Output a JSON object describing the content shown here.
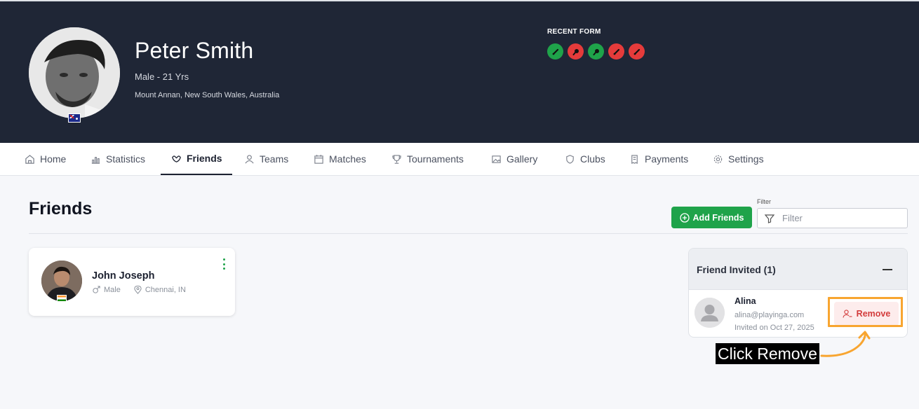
{
  "profile": {
    "name": "Peter Smith",
    "meta": "Male - 21 Yrs",
    "location": "Mount Annan, New South Wales, Australia",
    "recent_form_label": "RECENT FORM",
    "recent_form": [
      "win",
      "loss",
      "win",
      "loss",
      "loss"
    ]
  },
  "tabs": [
    {
      "label": "Home",
      "icon": "home-icon"
    },
    {
      "label": "Statistics",
      "icon": "statistics-icon"
    },
    {
      "label": "Friends",
      "icon": "friends-icon",
      "active": true
    },
    {
      "label": "Teams",
      "icon": "teams-icon"
    },
    {
      "label": "Matches",
      "icon": "calendar-icon"
    },
    {
      "label": "Tournaments",
      "icon": "trophy-icon"
    },
    {
      "label": "Gallery",
      "icon": "image-icon"
    },
    {
      "label": "Clubs",
      "icon": "shield-icon"
    },
    {
      "label": "Payments",
      "icon": "receipt-icon"
    },
    {
      "label": "Settings",
      "icon": "gear-icon"
    }
  ],
  "page": {
    "title": "Friends",
    "add_button": "Add Friends",
    "filter_label": "Filter",
    "filter_placeholder": "Filter"
  },
  "friends": [
    {
      "name": "John Joseph",
      "gender": "Male",
      "location": "Chennai, IN"
    }
  ],
  "invited": {
    "title": "Friend Invited (1)",
    "items": [
      {
        "name": "Alina",
        "email": "alina@playinga.com",
        "date": "Invited on Oct 27, 2025",
        "action": "Remove"
      }
    ]
  },
  "annotation": {
    "text": "Click Remove"
  },
  "colors": {
    "header_bg": "#1f2636",
    "win": "#1fa34a",
    "loss": "#e53b3b",
    "accent_green": "#1fa34a",
    "remove_red": "#d33b3b",
    "highlight": "#f8a530"
  }
}
